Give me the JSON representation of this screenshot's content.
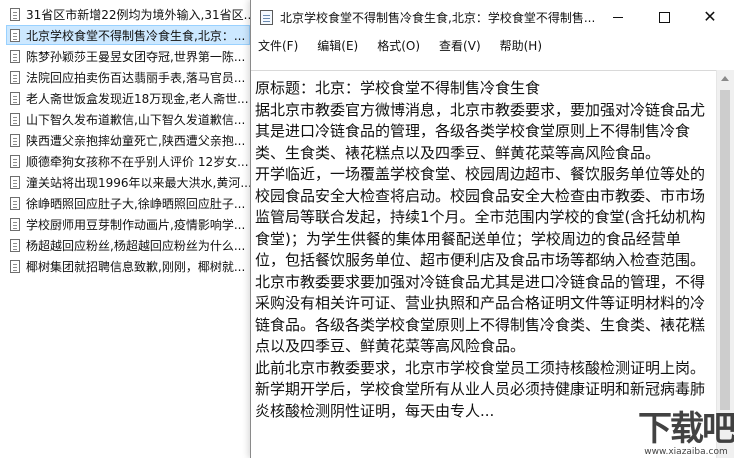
{
  "file_list": {
    "items": [
      {
        "label": "31省区市新增22例均为境外输入,31省区..."
      },
      {
        "label": "北京学校食堂不得制售冷食生食,北京：..."
      },
      {
        "label": "陈梦孙颖莎王曼昱女团夺冠,世界第一陈..."
      },
      {
        "label": "法院回应拍卖伤百达翡丽手表,落马官员..."
      },
      {
        "label": "老人斋世饭盒发现近18万现金,老人斋世..."
      },
      {
        "label": "山下智久发布道歉信,山下智久发道歉信..."
      },
      {
        "label": "陕西遭父亲抱摔幼童死亡,陕西遭父亲抱..."
      },
      {
        "label": "顺德牵狗女孩称不在乎别人评价 12岁女..."
      },
      {
        "label": "潼关站将出现1996年以来最大洪水,黄河..."
      },
      {
        "label": "徐峥晒照回应肚子大,徐峥晒照回应肚子..."
      },
      {
        "label": "学校厨师用豆芽制作动画片,疫情影响学..."
      },
      {
        "label": "杨超越回应粉丝,杨超越回应粉丝为什么..."
      },
      {
        "label": "椰树集团就招聘信息致歉,刚刚，椰树就..."
      }
    ],
    "selected_index": 1
  },
  "window": {
    "title": "北京学校食堂不得制售冷食生食,北京：学校食堂不得制售...",
    "menu": [
      "文件(F)",
      "编辑(E)",
      "格式(O)",
      "查看(V)",
      "帮助(H)"
    ],
    "content": "原标题：北京：学校食堂不得制售冷食生食\n据北京市教委官方微博消息，北京市教委要求，要加强对冷链食品尤其是进口冷链食品的管理，各级各类学校食堂原则上不得制售冷食类、生食类、裱花糕点以及四季豆、鲜黄花菜等高风险食品。\n开学临近，一场覆盖学校食堂、校园周边超市、餐饮服务单位等处的校园食品安全大检查将启动。校园食品安全大检查由市教委、市市场监管局等联合发起，持续1个月。全市范围内学校的食堂(含托幼机构食堂)；为学生供餐的集体用餐配送单位；学校周边的食品经营单位，包括餐饮服务单位、超市便利店及食品市场等都纳入检查范围。\n北京市教委要求要加强对冷链食品尤其是进口冷链食品的管理，不得采购没有相关许可证、营业执照和产品合格证明文件等证明材料的冷链食品。各级各类学校食堂原则上不得制售冷食类、生食类、裱花糕点以及四季豆、鲜黄花菜等高风险食品。\n此前北京市教委要求，北京市学校食堂员工须持核酸检测证明上岗。新学期开学后，学校食堂所有从业人员必须持健康证明和新冠病毒肺炎核酸检测阴性证明，每天由专人..."
  },
  "watermark": {
    "logo": "下载吧",
    "url": "www.xiazaiba.com"
  }
}
